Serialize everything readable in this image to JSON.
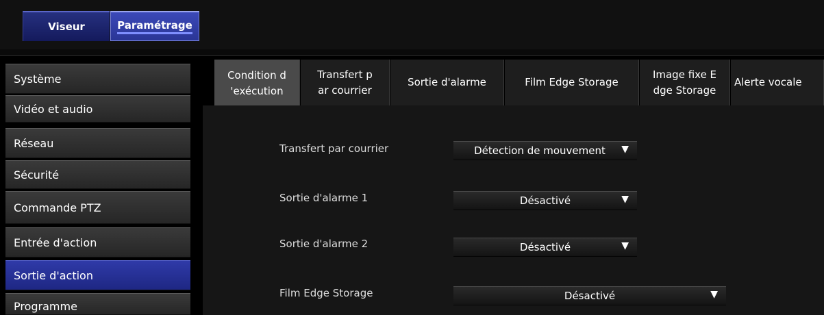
{
  "top_tabs": [
    "Viseur",
    "Paramétrage"
  ],
  "sidebar": {
    "items": [
      {
        "label": "Système"
      },
      {
        "label": "Vidéo et audio"
      },
      {
        "label": "Réseau"
      },
      {
        "label": "Sécurité"
      },
      {
        "label": "Commande PTZ"
      },
      {
        "label": "Entrée d'action"
      },
      {
        "label": "Sortie d'action"
      },
      {
        "label": "Programme"
      }
    ]
  },
  "tabs": [
    {
      "label": "Condition d\n'exécution"
    },
    {
      "label": "Transfert p\nar courrier"
    },
    {
      "label": "Sortie d'alarme"
    },
    {
      "label": "Film Edge Storage"
    },
    {
      "label": "Image fixe E\ndge Storage"
    },
    {
      "label": "Alerte vocale"
    }
  ],
  "form": {
    "rows": [
      {
        "label": "Transfert par courrier",
        "value": "Détection de mouvement"
      },
      {
        "label": "Sortie d'alarme 1",
        "value": "Désactivé"
      },
      {
        "label": "Sortie d'alarme 2",
        "value": "Désactivé"
      },
      {
        "label": "Film Edge Storage",
        "value": "Désactivé"
      }
    ],
    "arrow": "▼"
  },
  "colors": {
    "active_blue": "#2f3aa8",
    "background": "#000000"
  }
}
